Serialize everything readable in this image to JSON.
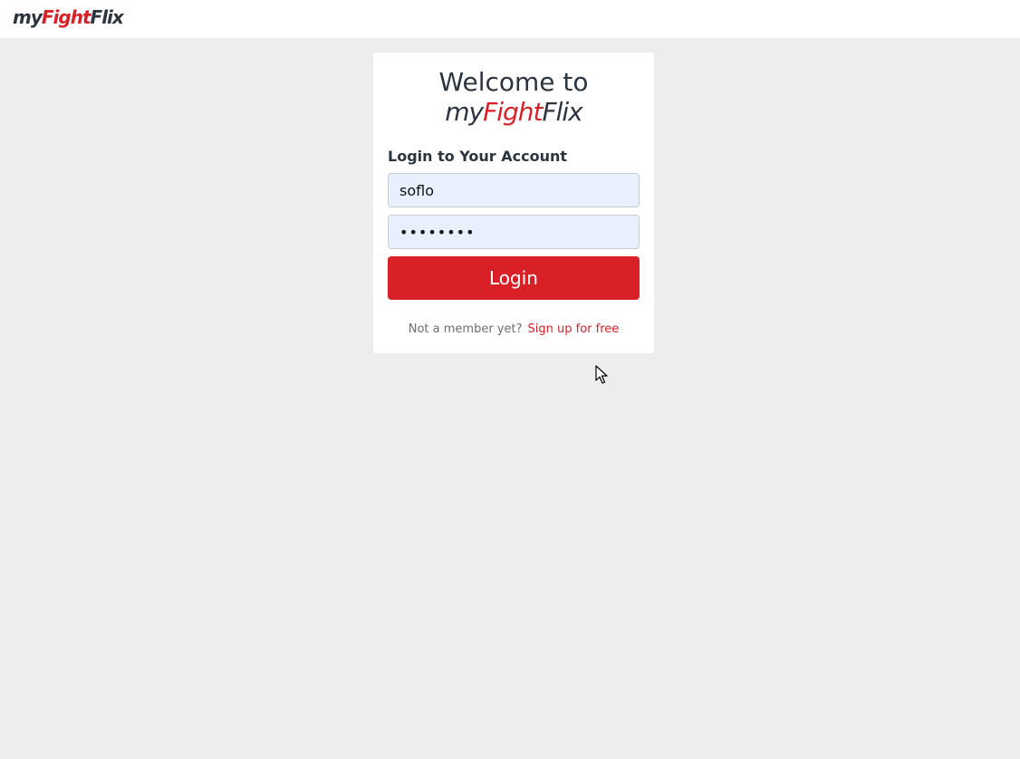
{
  "brand": {
    "part1": "my",
    "part2": "Fight",
    "part3": "Flix",
    "dark_color": "#2c3440",
    "accent_color": "#d92027"
  },
  "login_card": {
    "welcome_text": "Welcome to",
    "heading": "Login to Your Account",
    "username_value": "soflo",
    "password_value": "••••••••",
    "login_label": "Login",
    "signup_prompt": "Not a member yet?",
    "signup_link": "Sign up for free"
  },
  "icons": {
    "cursor": "mouse-pointer-icon"
  }
}
